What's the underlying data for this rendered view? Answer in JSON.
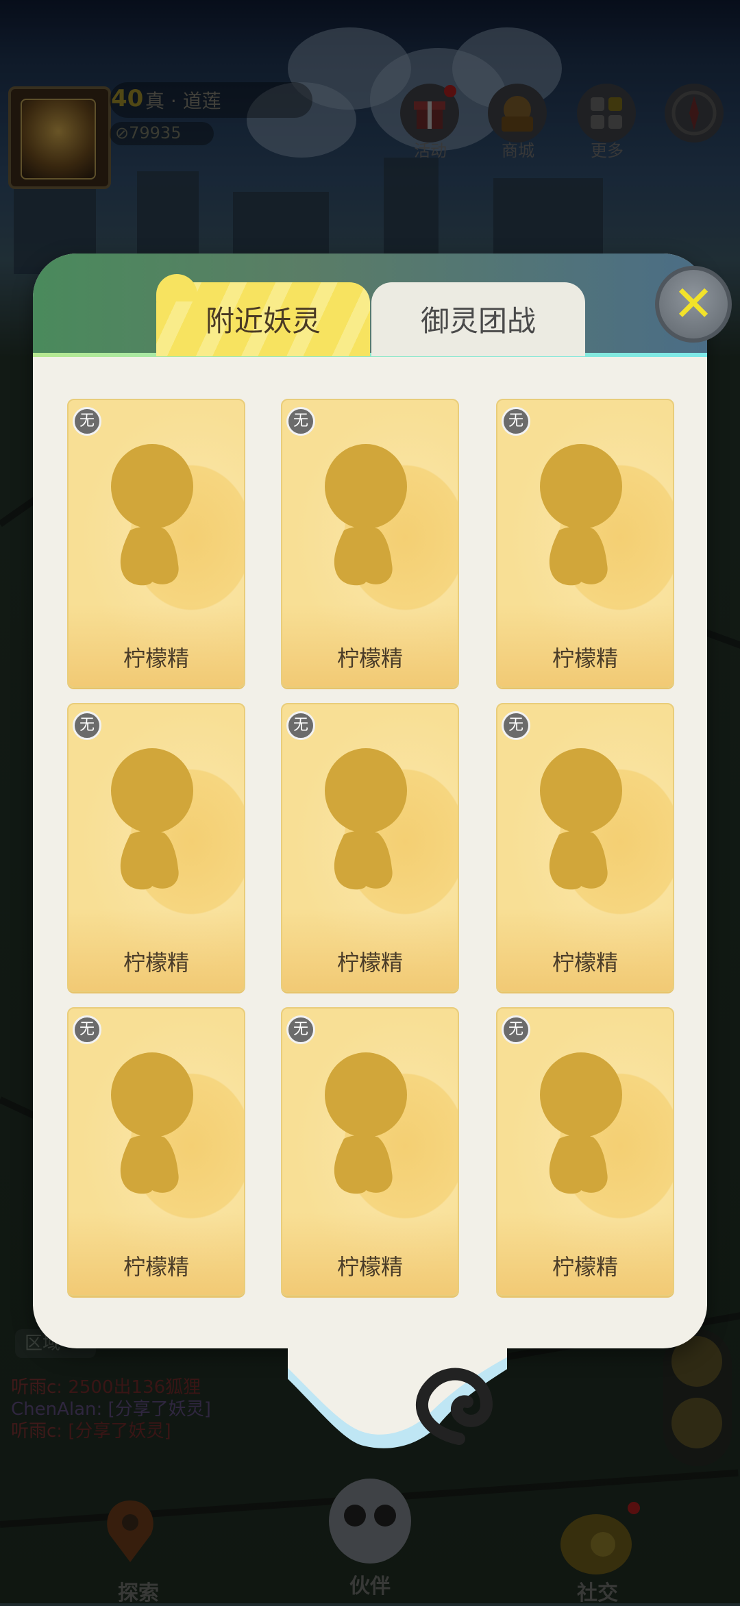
{
  "hud": {
    "level": "40",
    "player_name": "真 · 道莲",
    "coins": "⊘79935",
    "buttons": [
      {
        "label": "活动",
        "icon": "gift-icon"
      },
      {
        "label": "商城",
        "icon": "shop-icon"
      },
      {
        "label": "更多",
        "icon": "more-icon"
      },
      {
        "label": "",
        "icon": "compass-icon"
      }
    ]
  },
  "chat": {
    "area_label": "区域",
    "messages": [
      {
        "name": "听雨c",
        "text": ": 2500出136狐狸"
      },
      {
        "name": "ChenAlan",
        "text": ": [分享了妖灵]"
      },
      {
        "name": "听雨c",
        "text": ": [分享了妖灵]"
      }
    ]
  },
  "modal": {
    "tabs": [
      {
        "label": "附近妖灵",
        "active": true
      },
      {
        "label": "御灵团战",
        "active": false
      }
    ],
    "close_icon": "close-icon",
    "cards": [
      {
        "name": "柠檬精",
        "badge": "无"
      },
      {
        "name": "柠檬精",
        "badge": "无"
      },
      {
        "name": "柠檬精",
        "badge": "无"
      },
      {
        "name": "柠檬精",
        "badge": "无"
      },
      {
        "name": "柠檬精",
        "badge": "无"
      },
      {
        "name": "柠檬精",
        "badge": "无"
      },
      {
        "name": "柠檬精",
        "badge": "无"
      },
      {
        "name": "柠檬精",
        "badge": "无"
      },
      {
        "name": "柠檬精",
        "badge": "无"
      }
    ]
  },
  "bottom_nav": [
    {
      "label": "探索"
    },
    {
      "label": "伙伴"
    },
    {
      "label": "社交"
    }
  ],
  "colors": {
    "tab_active": "#f7e360",
    "card_bg": "#f8df95",
    "silhouette": "#d1a63a",
    "close_x": "#f2e22a"
  }
}
